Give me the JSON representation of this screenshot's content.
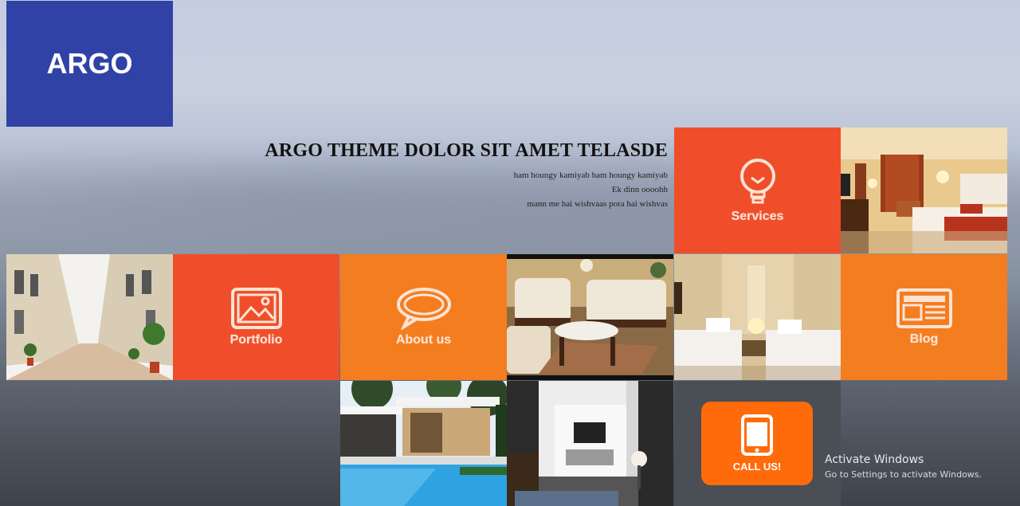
{
  "logo": {
    "text": "ARGO"
  },
  "hero": {
    "title": "ARGO THEME DOLOR SIT AMET TELASDE",
    "lines": [
      "ham houngy kamiyab ham houngy kamiyab",
      "Ek dinn oooohh",
      "mann me hai wishvaas pora hai wishvas"
    ]
  },
  "tiles": {
    "services": {
      "label": "Services",
      "icon": "lightbulb-icon",
      "color": "#f04e2a"
    },
    "portfolio": {
      "label": "Portfolio",
      "icon": "image-icon",
      "color": "#f04e2a"
    },
    "about": {
      "label": "About us",
      "icon": "speech-bubble-icon",
      "color": "#f47d20"
    },
    "blog": {
      "label": "Blog",
      "icon": "newspaper-icon",
      "color": "#f47d20"
    },
    "call": {
      "label": "CALL US!",
      "icon": "phone-icon",
      "color": "#ff6a0b"
    }
  },
  "photos": {
    "hotel_room": "hotel room photo",
    "street": "street photo",
    "living_room": "living room photo",
    "twin_room": "twin room photo",
    "pool_house": "pool house photo",
    "interior": "interior photo"
  },
  "watermark": {
    "title": "Activate Windows",
    "subtitle": "Go to Settings to activate Windows."
  }
}
